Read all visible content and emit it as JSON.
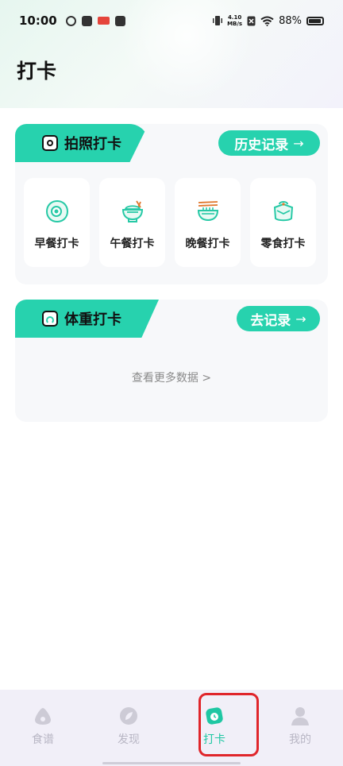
{
  "status_bar": {
    "time": "10:00",
    "net_speed_top": "4.10",
    "net_speed_bottom": "MB/s",
    "battery": "88%"
  },
  "page_title": "打卡",
  "photo_card": {
    "tab_label": "拍照打卡",
    "history_button": "历史记录",
    "meals": [
      {
        "label": "早餐打卡",
        "icon": "egg-icon"
      },
      {
        "label": "午餐打卡",
        "icon": "rice-bowl-icon"
      },
      {
        "label": "晚餐打卡",
        "icon": "noodle-bowl-icon"
      },
      {
        "label": "零食打卡",
        "icon": "snack-bag-icon"
      }
    ]
  },
  "weight_card": {
    "tab_label": "体重打卡",
    "record_button": "去记录",
    "more_link": "查看更多数据 >"
  },
  "bottom_nav": [
    {
      "label": "食谱",
      "icon": "recipe-icon",
      "active": false
    },
    {
      "label": "发现",
      "icon": "discover-icon",
      "active": false
    },
    {
      "label": "打卡",
      "icon": "checkin-icon",
      "active": true
    },
    {
      "label": "我的",
      "icon": "profile-icon",
      "active": false
    }
  ],
  "colors": {
    "accent": "#27d2ae",
    "highlight_ring": "#e0262b"
  }
}
